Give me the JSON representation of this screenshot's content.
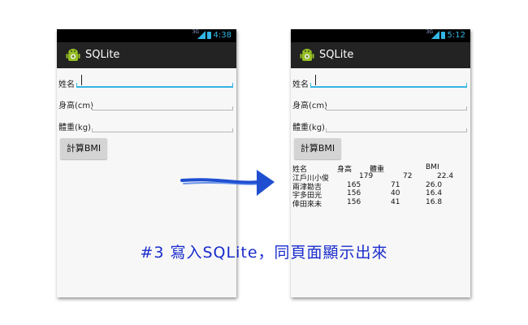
{
  "left_phone": {
    "status": {
      "network": "3G",
      "time": "4:38"
    },
    "app_title": "SQLite",
    "form": {
      "name_label": "姓名",
      "height_label": "身高(cm)",
      "weight_label": "體重(kg)",
      "button_label": "計算BMI"
    }
  },
  "right_phone": {
    "status": {
      "network": "3G",
      "time": "5:12"
    },
    "app_title": "SQLite",
    "form": {
      "name_label": "姓名",
      "height_label": "身高(cm)",
      "weight_label": "體重(kg)",
      "button_label": "計算BMI"
    },
    "results": {
      "headers": [
        "姓名",
        "身高",
        "體重",
        "BMI"
      ],
      "rows": [
        [
          "江戶川小俊",
          "179",
          "72",
          "22.4"
        ],
        [
          "兩津勘吉",
          "165",
          "71",
          "26.0"
        ],
        [
          "宇多田光",
          "156",
          "40",
          "16.4"
        ],
        [
          "倖田來未",
          "156",
          "41",
          "16.8"
        ]
      ]
    }
  },
  "caption": "#3 寫入SQLite，同頁面顯示出來",
  "icons": {
    "app": "android-icon",
    "arrow": "arrow-right-icon",
    "signal": "signal-icon",
    "battery": "battery-icon"
  },
  "colors": {
    "holo_blue": "#33b5e5",
    "caption": "#1a2ccd",
    "actionbar": "#232323"
  }
}
